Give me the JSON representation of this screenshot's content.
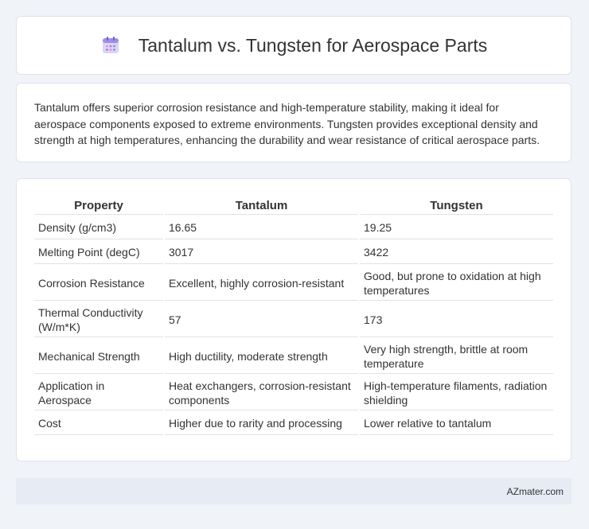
{
  "header": {
    "title": "Tantalum vs. Tungsten for Aerospace Parts",
    "icon": "calendar-icon"
  },
  "intro": {
    "text": "Tantalum offers superior corrosion resistance and high-temperature stability, making it ideal for aerospace components exposed to extreme environments. Tungsten provides exceptional density and strength at high temperatures, enhancing the durability and wear resistance of critical aerospace parts."
  },
  "table": {
    "headers": [
      "Property",
      "Tantalum",
      "Tungsten"
    ],
    "rows": [
      [
        "Density (g/cm3)",
        "16.65",
        "19.25"
      ],
      [
        "Melting Point (degC)",
        "3017",
        "3422"
      ],
      [
        "Corrosion Resistance",
        "Excellent, highly corrosion-resistant",
        "Good, but prone to oxidation at high temperatures"
      ],
      [
        "Thermal Conductivity (W/m*K)",
        "57",
        "173"
      ],
      [
        "Mechanical Strength",
        "High ductility, moderate strength",
        "Very high strength, brittle at room temperature"
      ],
      [
        "Application in Aerospace",
        "Heat exchangers, corrosion-resistant components",
        "High-temperature filaments, radiation shielding"
      ],
      [
        "Cost",
        "Higher due to rarity and processing",
        "Lower relative to tantalum"
      ]
    ]
  },
  "footer": {
    "site": "AZmater.com"
  }
}
